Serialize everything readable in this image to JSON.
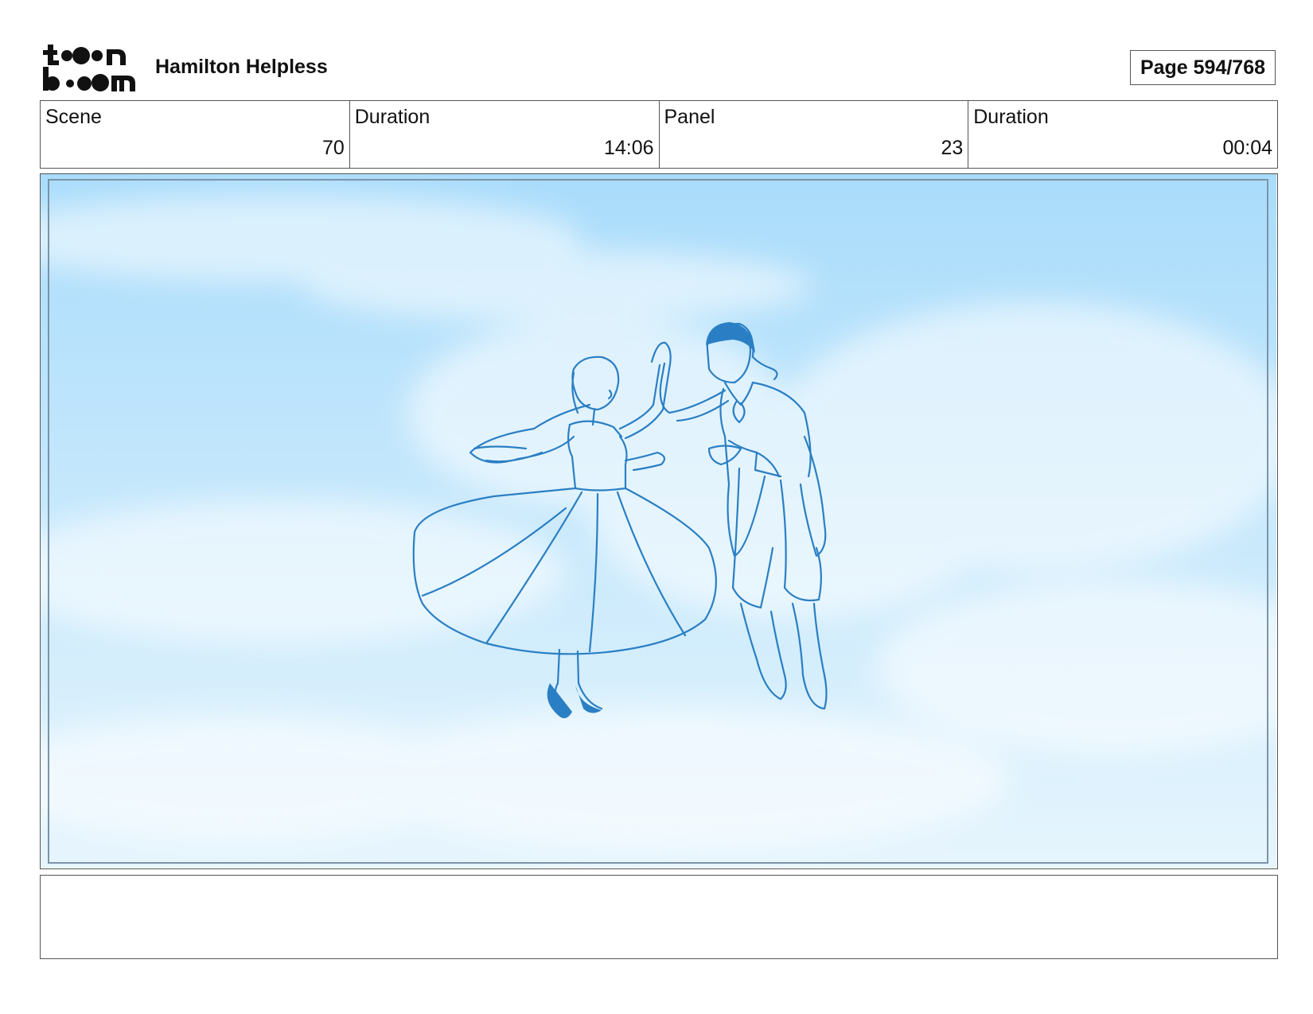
{
  "header": {
    "project_title": "Hamilton Helpless",
    "page_label": "Page 594/768"
  },
  "logo": {
    "text": "toon boom",
    "icon": "toon-boom-logo"
  },
  "info": {
    "scene_label": "Scene",
    "scene_value": "70",
    "scene_duration_label": "Duration",
    "scene_duration_value": "14:06",
    "panel_label": "Panel",
    "panel_value": "23",
    "panel_duration_label": "Duration",
    "panel_duration_value": "00:04"
  },
  "panel": {
    "sky_top_color": "#a9dcfb",
    "sky_bottom_color": "#e6f5fd",
    "sketch_color": "#2a7fc4"
  },
  "notes": {
    "text": ""
  }
}
